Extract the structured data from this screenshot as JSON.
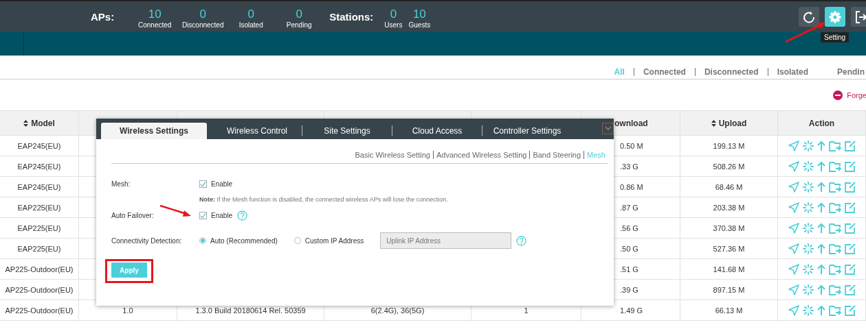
{
  "header": {
    "aps_label": "APs:",
    "ap_stats": [
      {
        "value": "10",
        "label": "Connected"
      },
      {
        "value": "0",
        "label": "Disconnected"
      },
      {
        "value": "0",
        "label": "Isolated"
      },
      {
        "value": "0",
        "label": "Pending"
      }
    ],
    "stations_label": "Stations:",
    "station_stats": [
      {
        "value": "0",
        "label": "Users"
      },
      {
        "value": "10",
        "label": "Guests"
      }
    ],
    "toolbar": [
      {
        "kind": "refresh",
        "selected": false
      },
      {
        "kind": "settings",
        "selected": true,
        "tooltip": "Setting"
      },
      {
        "kind": "logout",
        "selected": false
      }
    ]
  },
  "filter_tabs": [
    {
      "label": "All",
      "selected": true
    },
    {
      "label": "Connected",
      "selected": false
    },
    {
      "label": "Disconnected",
      "selected": false
    },
    {
      "label": "Isolated",
      "selected": false
    },
    {
      "label": "Pendin",
      "selected": false
    }
  ],
  "forget_link": "Forge",
  "table": {
    "columns": {
      "model": "Model",
      "download": "ownload",
      "upload": "Upload",
      "action": "Action"
    },
    "rows": [
      {
        "model": "EAP245(EU)",
        "download": "0.50 M",
        "upload": "199.13 M"
      },
      {
        "model": "EAP245(EU)",
        "download": ".33 G",
        "upload": "508.26 M"
      },
      {
        "model": "EAP245(EU)",
        "download": "0.86 M",
        "upload": "68.46 M"
      },
      {
        "model": "EAP225(EU)",
        "download": ".87 G",
        "upload": "203.38 M"
      },
      {
        "model": "EAP225(EU)",
        "download": ".56 G",
        "upload": "370.38 M"
      },
      {
        "model": "EAP225(EU)",
        "download": ".50 G",
        "upload": "527.36 M"
      },
      {
        "model": "AP225-Outdoor(EU)",
        "download": ".51 G",
        "upload": "141.68 M"
      },
      {
        "model": "AP225-Outdoor(EU)",
        "download": ".39 G",
        "upload": "897.15 M"
      },
      {
        "model": "AP225-Outdoor(EU)",
        "column_2": "1.0",
        "column_3": "1.3.0 Build 20180614 Rel. 50359",
        "column_4": "6(2.4G), 36(5G)",
        "column_5": "1",
        "download": "1.49 G",
        "upload": "66.13 M"
      }
    ]
  },
  "dialog": {
    "tabs": [
      {
        "label": "Wireless Settings",
        "selected": true
      },
      {
        "label": "Wireless Control",
        "selected": false
      },
      {
        "label": "Site Settings",
        "selected": false
      },
      {
        "label": "Cloud Access",
        "selected": false
      },
      {
        "label": "Controller Settings",
        "selected": false
      }
    ],
    "subtabs": [
      {
        "label": "Basic Wireless Setting",
        "selected": false
      },
      {
        "label": "Advanced Wireless Setting",
        "selected": false
      },
      {
        "label": "Band Steering",
        "selected": false
      },
      {
        "label": "Mesh",
        "selected": true
      }
    ],
    "mesh": {
      "label": "Mesh:",
      "option": "Enable",
      "checked": true
    },
    "note": "**Note:** If the Mesh function is disabled, the connected wireless APs will lose the connection.",
    "auto_failover": {
      "label": "Auto Failover:",
      "option": "Enable",
      "checked": true
    },
    "connectivity": {
      "label": "Connectivity Detection:",
      "options": [
        {
          "label": "Auto (Recommended)",
          "selected": true
        },
        {
          "label": "Custom IP Address",
          "selected": false
        }
      ],
      "placeholder": "Uplink IP Address"
    },
    "apply": "Apply"
  }
}
